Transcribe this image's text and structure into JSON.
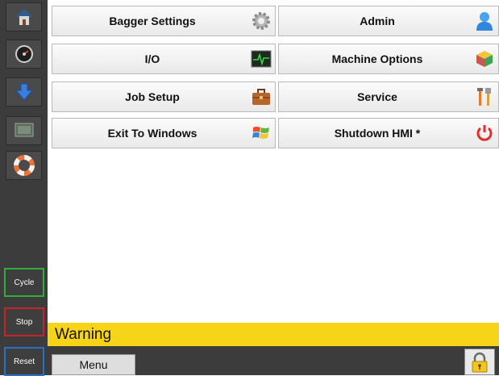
{
  "sidebar": {
    "buttons": [
      {
        "icon": "home-icon"
      },
      {
        "icon": "gauge-icon"
      },
      {
        "icon": "download-arrow-icon"
      },
      {
        "icon": "screen-icon"
      },
      {
        "icon": "lifebuoy-icon"
      }
    ],
    "cycle_label": "Cycle",
    "stop_label": "Stop",
    "reset_label": "Reset"
  },
  "menu": {
    "bagger_settings": "Bagger Settings",
    "admin": "Admin",
    "io": "I/O",
    "machine_options": "Machine Options",
    "job_setup": "Job Setup",
    "service": "Service",
    "exit_to_windows": "Exit To Windows",
    "shutdown_hmi": "Shutdown HMI *"
  },
  "status": {
    "warning_text": "Warning"
  },
  "bottom": {
    "menu_label": "Menu",
    "lock_icon": "padlock-icon"
  },
  "colors": {
    "warning_bar": "#f7d417",
    "sidebar": "#3c3c3c",
    "cycle_border": "#2fae3a",
    "stop_border": "#c8232c",
    "reset_border": "#2c6fc7"
  }
}
